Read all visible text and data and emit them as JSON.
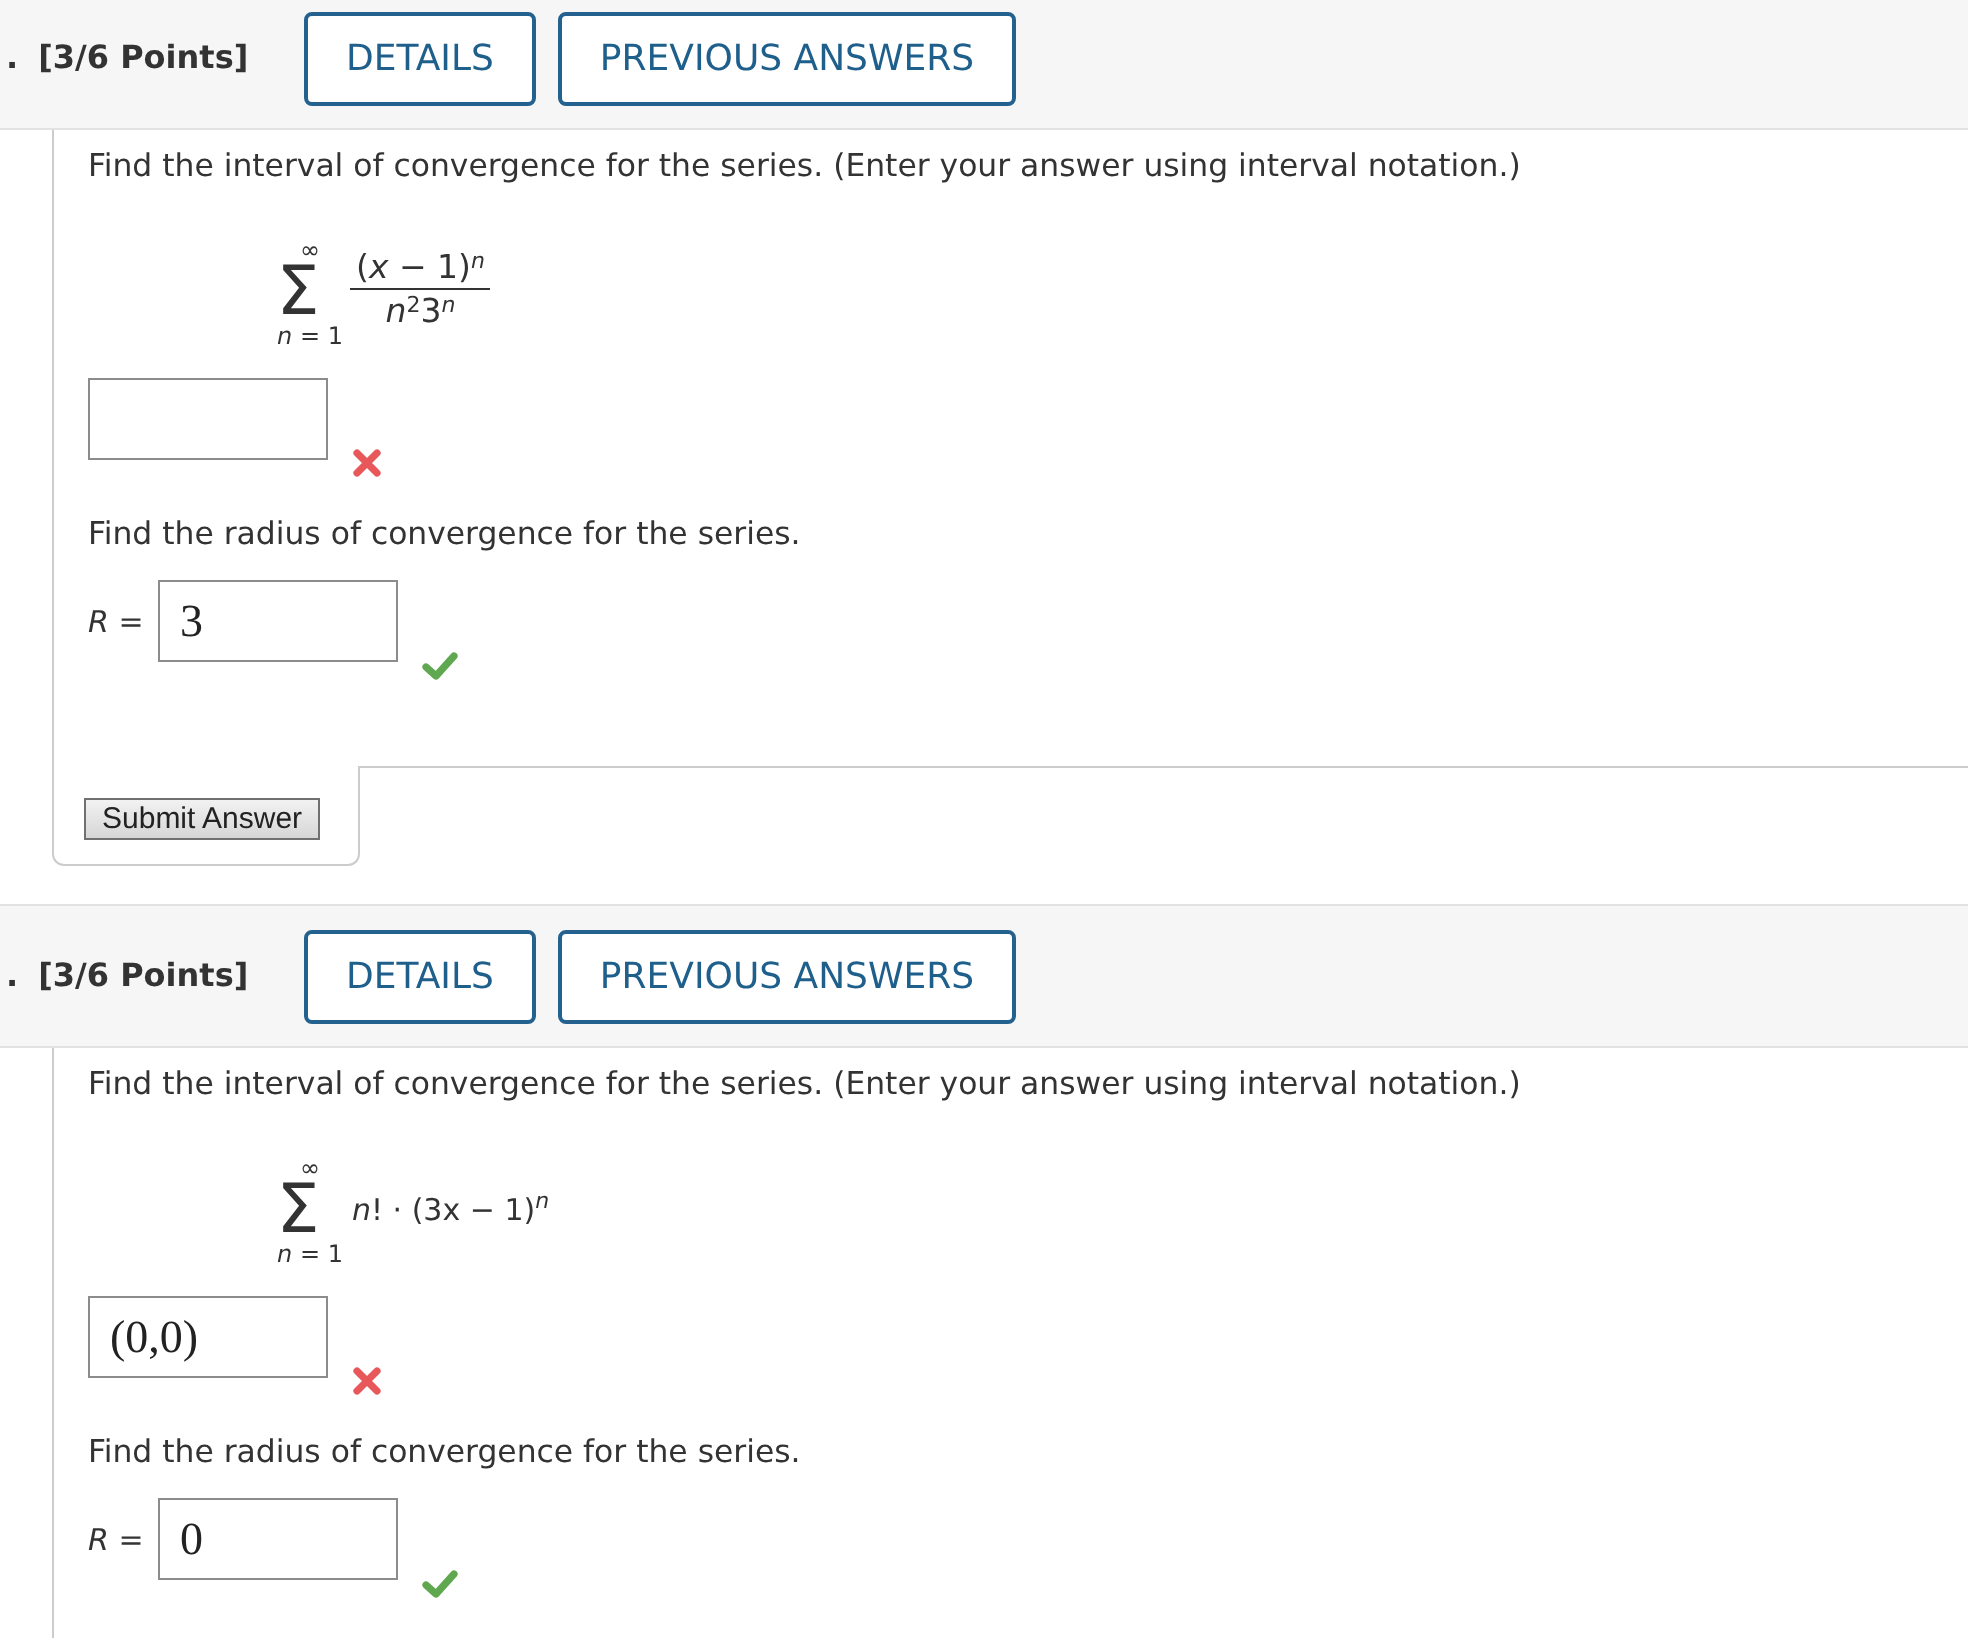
{
  "questions": [
    {
      "number": ".",
      "points": "[3/6 Points]",
      "buttons": [
        "DETAILS",
        "PREVIOUS ANSWERS"
      ],
      "parts": [
        {
          "kind": "prompt",
          "text": "Find the interval of convergence for the series. (Enter your answer using interval notation.)"
        },
        {
          "kind": "series",
          "upper": "∞",
          "symbol": "Σ",
          "lower": "*n* = 1",
          "numerator": "(*x* − 1)$^{n}$",
          "denominator": "*n*$^{2}$3$^{n}$"
        },
        {
          "kind": "answer",
          "correct": false
        },
        {
          "kind": "prompt",
          "text": "Find the radius of convergence for the series."
        },
        {
          "kind": "answer",
          "label": "*R* =",
          "value": "3",
          "correct": true
        }
      ],
      "submit_button": "Submit Answer"
    },
    {
      "number": ".",
      "points": "[3/6 Points]",
      "buttons": [
        "DETAILS",
        "PREVIOUS ANSWERS"
      ],
      "parts": [
        {
          "kind": "prompt",
          "text": "Find the interval of convergence for the series. (Enter your answer using interval notation.)"
        },
        {
          "kind": "series",
          "upper": "∞",
          "symbol": "Σ",
          "lower": "*n* = 1",
          "term": "*n*! · (3x − 1)$^{n}$"
        },
        {
          "kind": "answer",
          "value": "(0,0)",
          "correct": false
        },
        {
          "kind": "prompt",
          "text": "Find the radius of convergence for the series."
        },
        {
          "kind": "answer",
          "label": "*R* =",
          "value": "0",
          "correct": true
        }
      ]
    }
  ]
}
